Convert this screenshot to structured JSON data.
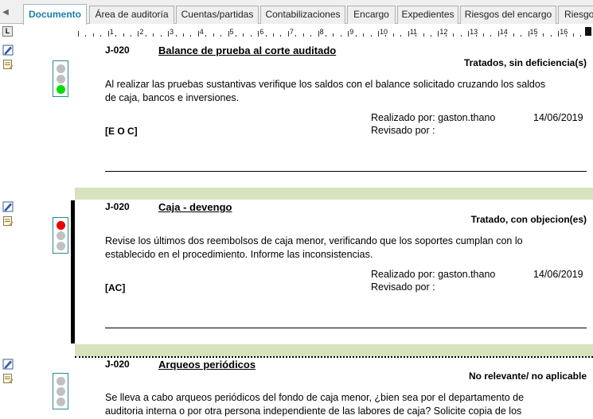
{
  "tabs": [
    {
      "label": "Documento",
      "active": true
    },
    {
      "label": "Área de auditoría",
      "active": false
    },
    {
      "label": "Cuentas/partidas",
      "active": false
    },
    {
      "label": "Contabilizaciones",
      "active": false
    },
    {
      "label": "Encargo",
      "active": false
    },
    {
      "label": "Expedientes",
      "active": false
    },
    {
      "label": "Riesgos del encargo",
      "active": false
    },
    {
      "label": "Riesgo",
      "active": false
    }
  ],
  "ruler": {
    "corner": "L",
    "numbers": [
      "1",
      "2",
      "3",
      "4",
      "5",
      "6",
      "7",
      "8",
      "9",
      "10",
      "11",
      "12",
      "13",
      "14",
      "15",
      "16"
    ]
  },
  "colors": {
    "accent_tab": "#1a7fa8",
    "separator": "#d6e3bd",
    "light_green": "#00dd00",
    "light_red": "#ee0000",
    "light_off": "#c0c0c0",
    "light_border": "#2a8a8a"
  },
  "icons": {
    "edit": "edit-pencil-icon",
    "note": "note-icon",
    "scroll_left": "chevron-left-icon"
  },
  "records": [
    {
      "code": "J-020",
      "title": "Balance de prueba al corte auditado",
      "status": "Tratados, sin deficiencia(s)",
      "traffic_light": "green",
      "body": "Al realizar las pruebas sustantivas verifique los saldos con el balance solicitado cruzando los saldos de caja, bancos e inversiones.",
      "performed_by": "Realizado por: gaston.thano",
      "date": "14/06/2019",
      "reviewed_by": "Revisado por :",
      "tag": "[E O C]"
    },
    {
      "code": "J-020",
      "title": "Caja - devengo",
      "status": "Tratado, con objecion(es)",
      "traffic_light": "red",
      "body": "Revise los últimos dos reembolsos de caja menor, verificando que los soportes cumplan con lo establecido en el procedimiento. Informe las inconsistencias.",
      "performed_by": "Realizado por: gaston.thano",
      "date": "14/06/2019",
      "reviewed_by": "Revisado por :",
      "tag": "[AC]"
    },
    {
      "code": "J-020",
      "title": "Arqueos periódicos",
      "status": "No relevante/ no aplicable",
      "traffic_light": "none",
      "body": "Se lleva a cabo arqueos periódicos del fondo de caja menor, ¿bien sea por el departamento de auditoria interna o por otra persona independiente de las labores de caja? Solicite copia de los"
    }
  ]
}
